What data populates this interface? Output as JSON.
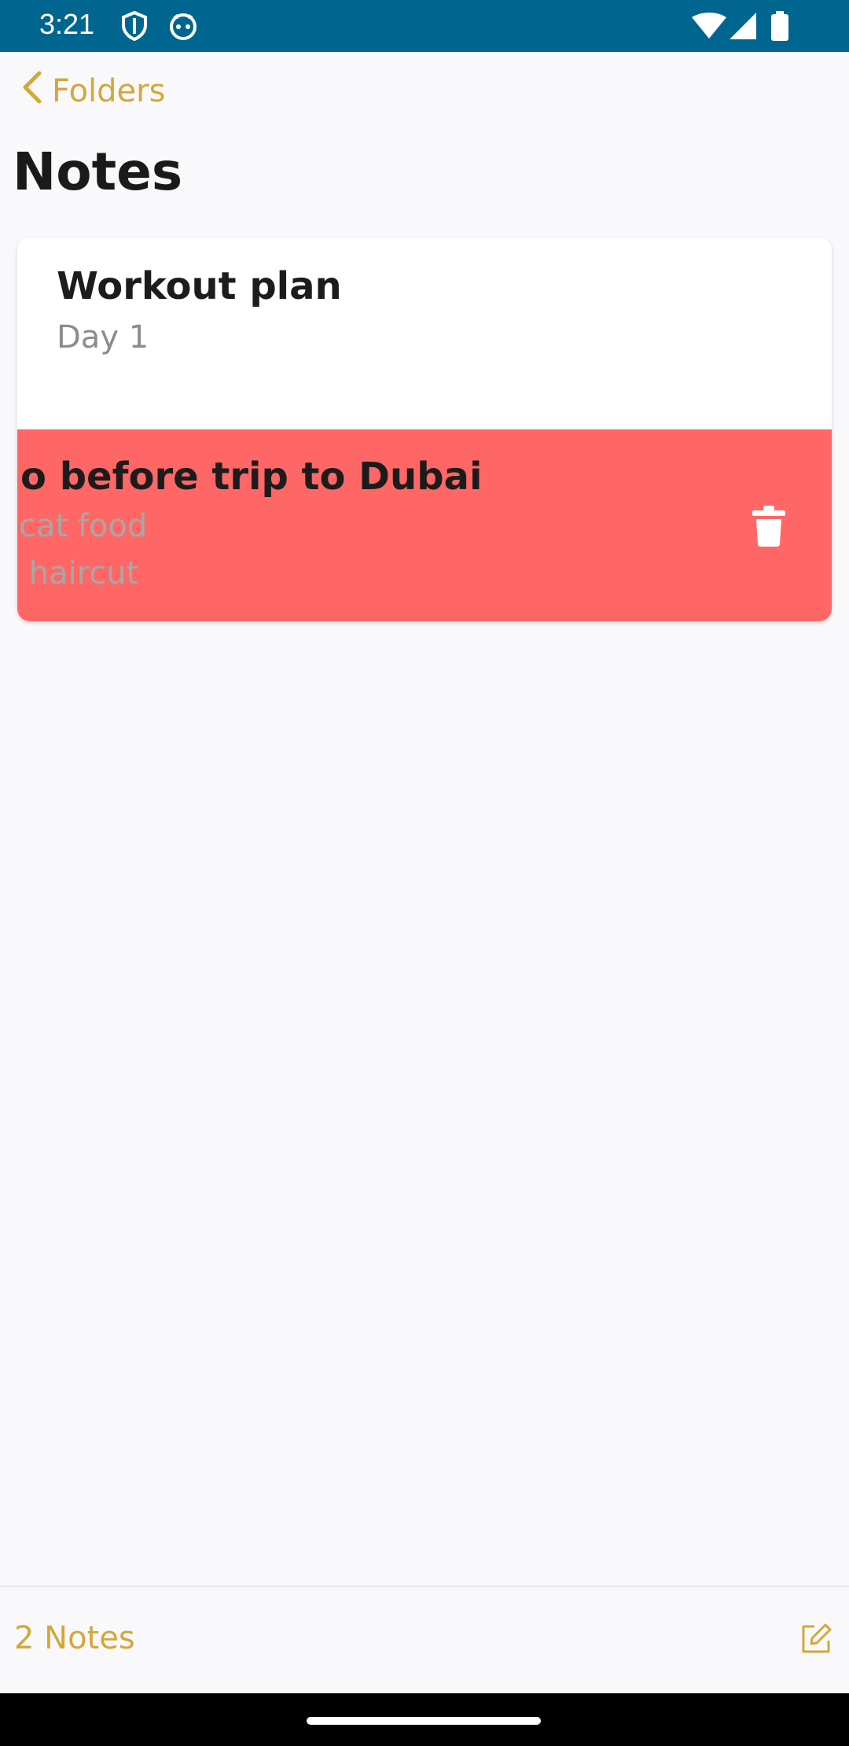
{
  "status_bar": {
    "time": "3:21",
    "icons": [
      "shield-icon",
      "cat-face-icon",
      "wifi-icon",
      "signal-icon",
      "battery-icon"
    ],
    "background": "#00668f"
  },
  "nav": {
    "back_label": "Folders",
    "accent": "#d4a73a"
  },
  "page": {
    "title": "Notes"
  },
  "notes": [
    {
      "title": "Workout plan",
      "preview_lines": [
        "Day 1"
      ]
    },
    {
      "title": "o before trip to Dubai",
      "preview_lines": [
        "cat food",
        " haircut"
      ],
      "swipe_action_color": "#ff6766",
      "swipe_action_icon": "trash-icon"
    }
  ],
  "footer": {
    "count_label": "2 Notes",
    "compose_icon": "compose-icon"
  }
}
